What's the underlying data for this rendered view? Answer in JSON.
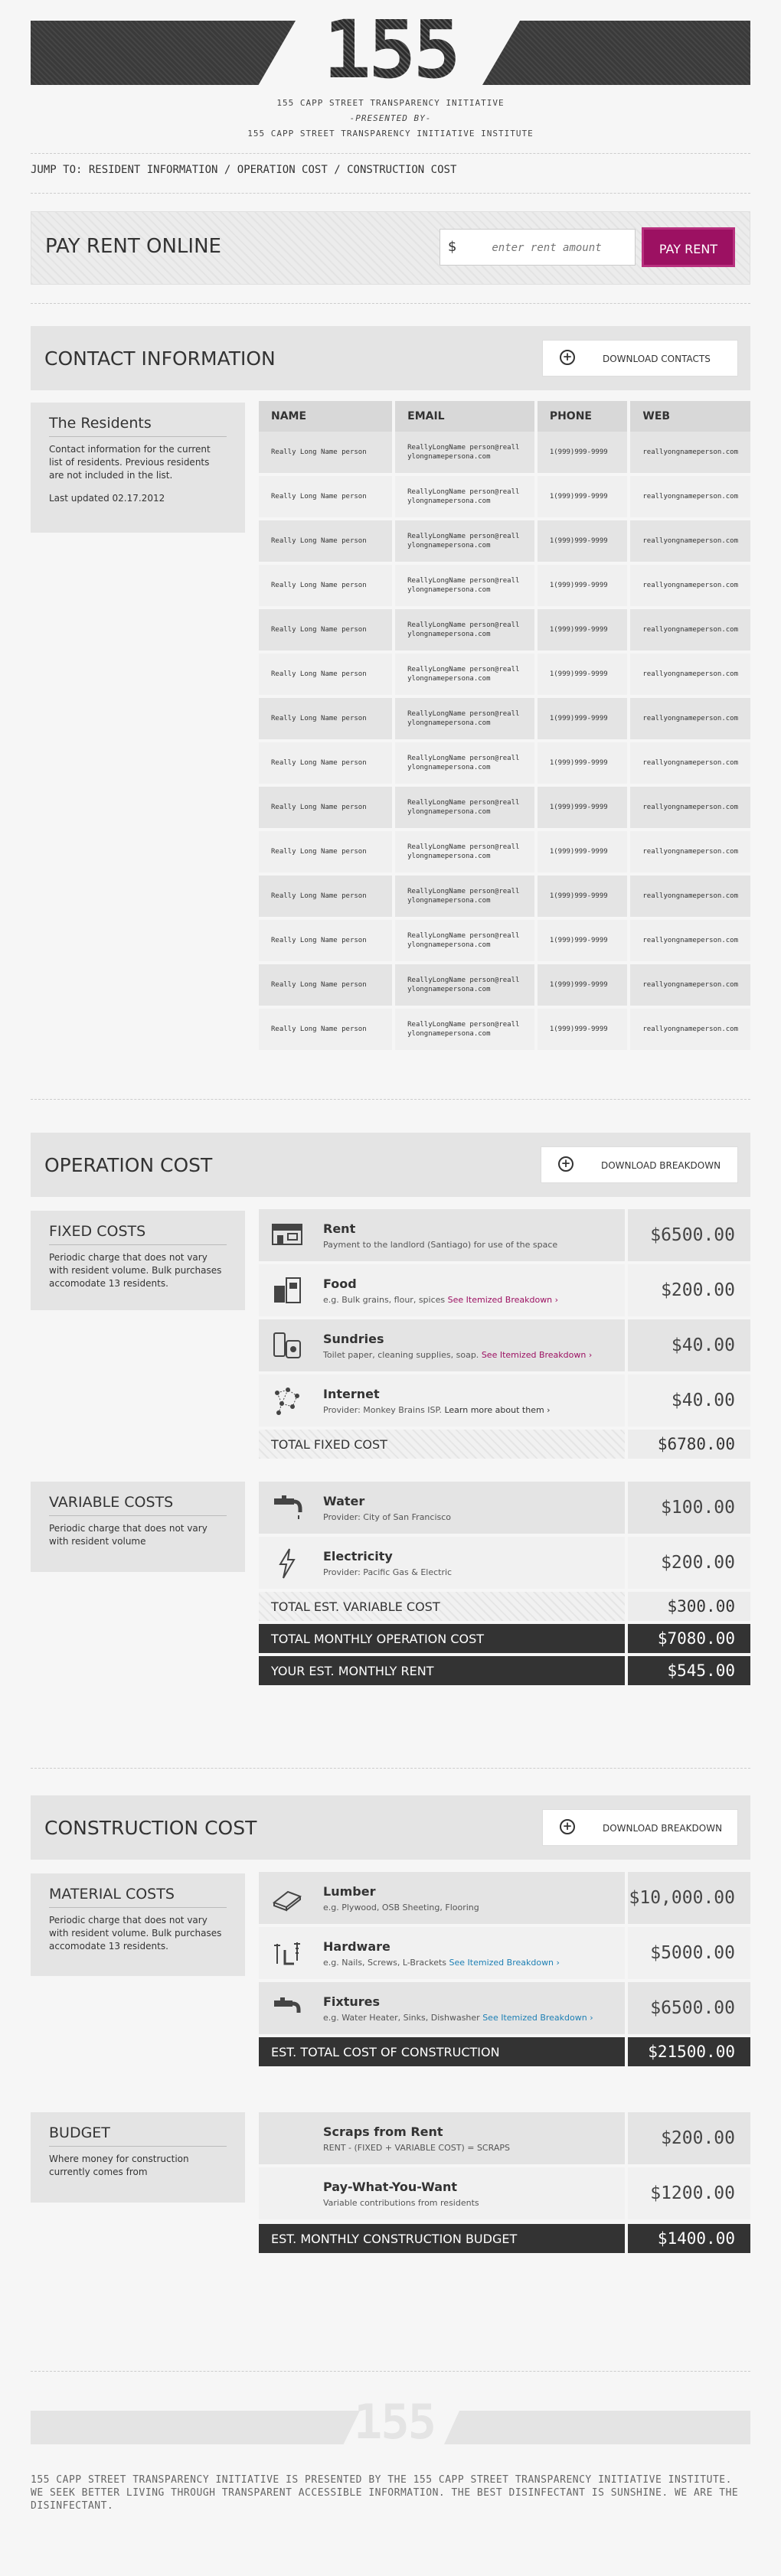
{
  "header": {
    "logo": "155",
    "line1": "155 CAPP STREET TRANSPARENCY INITIATIVE",
    "line2": "-PRESENTED BY-",
    "line3": "155 CAPP STREET TRANSPARENCY INITIATIVE INSTITUTE"
  },
  "jump": {
    "prefix": "JUMP TO:",
    "links": [
      "RESIDENT INFORMATION",
      "OPERATION COST",
      "CONSTRUCTION COST"
    ],
    "sep": "/"
  },
  "pay": {
    "title": "PAY RENT ONLINE",
    "currency": "$",
    "placeholder": "enter rent amount",
    "button": "PAY RENT"
  },
  "contact": {
    "title": "CONTACT INFORMATION",
    "download": "DOWNLOAD CONTACTS",
    "card_title": "The Residents",
    "card_desc": "Contact information for the current list of residents. Previous residents are not included in the list.",
    "card_updated": "Last updated 02.17.2012",
    "columns": [
      "NAME",
      "EMAIL",
      "PHONE",
      "WEB"
    ],
    "rows": [
      [
        "Really Long Name person",
        "ReallyLongName person@reallylongnamepersona.com",
        "1(999)999-9999",
        "reallyongnameperson.com"
      ],
      [
        "Really Long Name person",
        "ReallyLongName person@reallylongnamepersona.com",
        "1(999)999-9999",
        "reallyongnameperson.com"
      ],
      [
        "Really Long Name person",
        "ReallyLongName person@reallylongnamepersona.com",
        "1(999)999-9999",
        "reallyongnameperson.com"
      ],
      [
        "Really Long Name person",
        "ReallyLongName person@reallylongnamepersona.com",
        "1(999)999-9999",
        "reallyongnameperson.com"
      ],
      [
        "Really Long Name person",
        "ReallyLongName person@reallylongnamepersona.com",
        "1(999)999-9999",
        "reallyongnameperson.com"
      ],
      [
        "Really Long Name person",
        "ReallyLongName person@reallylongnamepersona.com",
        "1(999)999-9999",
        "reallyongnameperson.com"
      ],
      [
        "Really Long Name person",
        "ReallyLongName person@reallylongnamepersona.com",
        "1(999)999-9999",
        "reallyongnameperson.com"
      ],
      [
        "Really Long Name person",
        "ReallyLongName person@reallylongnamepersona.com",
        "1(999)999-9999",
        "reallyongnameperson.com"
      ],
      [
        "Really Long Name person",
        "ReallyLongName person@reallylongnamepersona.com",
        "1(999)999-9999",
        "reallyongnameperson.com"
      ],
      [
        "Really Long Name person",
        "ReallyLongName person@reallylongnamepersona.com",
        "1(999)999-9999",
        "reallyongnameperson.com"
      ],
      [
        "Really Long Name person",
        "ReallyLongName person@reallylongnamepersona.com",
        "1(999)999-9999",
        "reallyongnameperson.com"
      ],
      [
        "Really Long Name person",
        "ReallyLongName person@reallylongnamepersona.com",
        "1(999)999-9999",
        "reallyongnameperson.com"
      ],
      [
        "Really Long Name person",
        "ReallyLongName person@reallylongnamepersona.com",
        "1(999)999-9999",
        "reallyongnameperson.com"
      ],
      [
        "Really Long Name person",
        "ReallyLongName person@reallylongnamepersona.com",
        "1(999)999-9999",
        "reallyongnameperson.com"
      ]
    ]
  },
  "operation": {
    "title": "OPERATION COST",
    "download": "DOWNLOAD BREAKDOWN",
    "fixed_title": "FIXED COSTS",
    "fixed_desc": "Periodic charge that does not vary with resident volume. Bulk purchases accomodate 13 residents.",
    "rent": {
      "name": "Rent",
      "desc": "Payment to the landlord (Santiago) for use of the space",
      "value": "$6500.00"
    },
    "food": {
      "name": "Food",
      "desc": "e.g. Bulk grains, flour, spices",
      "link": "See Itemized Breakdown ›",
      "value": "$200.00"
    },
    "sundries": {
      "name": "Sundries",
      "desc": "Toilet paper, cleaning supplies, soap.",
      "link": "See Itemized Breakdown ›",
      "value": "$40.00"
    },
    "internet": {
      "name": "Internet",
      "desc": "Provider: Monkey Brains ISP.",
      "link": "Learn more about them ›",
      "value": "$40.00"
    },
    "total_fixed_label": "TOTAL FIXED COST",
    "total_fixed_value": "$6780.00",
    "variable_title": "VARIABLE COSTS",
    "variable_desc": "Periodic charge that does not vary with resident volume",
    "water": {
      "name": "Water",
      "desc": "Provider: City of San Francisco",
      "value": "$100.00"
    },
    "electricity": {
      "name": "Electricity",
      "desc": "Provider: Pacific Gas & Electric",
      "value": "$200.00"
    },
    "total_variable_label": "TOTAL EST. VARIABLE COST",
    "total_variable_value": "$300.00",
    "total_monthly_label": "TOTAL MONTHLY OPERATION COST",
    "total_monthly_value": "$7080.00",
    "your_rent_label": "YOUR EST. MONTHLY RENT",
    "your_rent_value": "$545.00"
  },
  "construction": {
    "title": "CONSTRUCTION COST",
    "download": "DOWNLOAD BREAKDOWN",
    "material_title": "MATERIAL COSTS",
    "material_desc": "Periodic charge that does not vary with resident volume. Bulk purchases accomodate 13 residents.",
    "lumber": {
      "name": "Lumber",
      "desc": "e.g. Plywood, OSB Sheeting, Flooring",
      "value": "$10,000.00"
    },
    "hardware": {
      "name": "Hardware",
      "desc": "e.g. Nails, Screws, L-Brackets",
      "link": "See Itemized Breakdown ›",
      "value": "$5000.00"
    },
    "fixtures": {
      "name": "Fixtures",
      "desc": "e.g. Water Heater, Sinks, Dishwasher",
      "link": "See Itemized Breakdown ›",
      "value": "$6500.00"
    },
    "total_label": "EST. TOTAL COST OF CONSTRUCTION",
    "total_value": "$21500.00",
    "budget_title": "BUDGET",
    "budget_desc": "Where money for construction currently comes from",
    "scraps": {
      "name": "Scraps from Rent",
      "desc": "RENT - (FIXED + VARIABLE COST) = SCRAPS",
      "value": "$200.00"
    },
    "pwyw": {
      "name": "Pay-What-You-Want",
      "desc": "Variable contributions from residents",
      "value": "$1200.00"
    },
    "budget_total_label": "EST. MONTHLY CONSTRUCTION BUDGET",
    "budget_total_value": "$1400.00"
  },
  "footer": {
    "logo": "155",
    "text": "155 CAPP STREET TRANSPARENCY INITIATIVE IS PRESENTED BY THE 155 CAPP STREET TRANSPARENCY INITIATIVE INSTITUTE. WE SEEK BETTER LIVING THROUGH TRANSPARENT ACCESSIBLE INFORMATION. THE BEST DISINFECTANT IS SUNSHINE. WE ARE THE DISINFECTANT."
  },
  "colors": {
    "accent": "#9c1162",
    "link_blue": "#1d7fb4",
    "dark": "#333333"
  }
}
